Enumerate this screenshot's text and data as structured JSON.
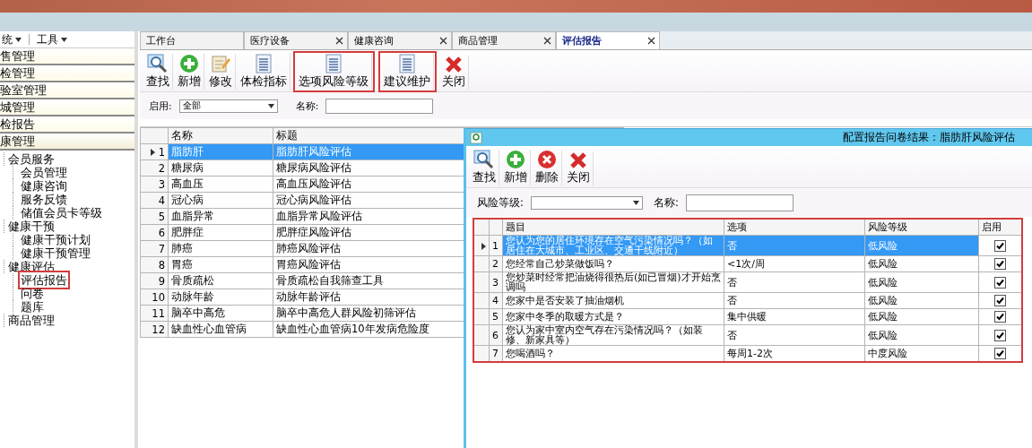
{
  "menu": [
    {
      "label": "统"
    },
    {
      "label": "工具"
    }
  ],
  "nav_sections": [
    {
      "label": "售管理",
      "expanded": false
    },
    {
      "label": "检管理",
      "expanded": false
    },
    {
      "label": "验室管理",
      "expanded": false
    },
    {
      "label": "城管理",
      "expanded": false
    },
    {
      "label": "检报告",
      "expanded": false
    },
    {
      "label": "康管理",
      "expanded": true
    }
  ],
  "tree": [
    {
      "label": "会员服务",
      "children": [
        {
          "label": "会员管理"
        },
        {
          "label": "健康咨询"
        },
        {
          "label": "服务反馈"
        },
        {
          "label": "储值会员卡等级"
        }
      ]
    },
    {
      "label": "健康干预",
      "children": [
        {
          "label": "健康干预计划"
        },
        {
          "label": "健康干预管理"
        }
      ]
    },
    {
      "label": "健康评估",
      "children": [
        {
          "label": "评估报告",
          "annotated": true
        },
        {
          "label": "问卷"
        },
        {
          "label": "题库"
        }
      ]
    },
    {
      "label": "商品管理"
    }
  ],
  "tabs": [
    {
      "label": "工作台",
      "closable": false,
      "selected": false
    },
    {
      "label": "医疗设备",
      "closable": true,
      "selected": false
    },
    {
      "label": "健康咨询",
      "closable": true,
      "selected": false
    },
    {
      "label": "商品管理",
      "closable": true,
      "selected": false
    },
    {
      "label": "评估报告",
      "closable": true,
      "selected": true
    }
  ],
  "toolbar": [
    {
      "label": "查找",
      "kind": "search"
    },
    {
      "label": "新增",
      "kind": "add"
    },
    {
      "label": "修改",
      "kind": "edit"
    },
    {
      "label": "体检指标",
      "kind": "doc"
    },
    {
      "label": "选项风险等级",
      "kind": "doc",
      "annotated": true
    },
    {
      "label": "建议维护",
      "kind": "doc",
      "annotated": true
    },
    {
      "label": "关闭",
      "kind": "close"
    }
  ],
  "filter": {
    "enabled_label": "启用:",
    "enabled_value": "全部",
    "name_label": "名称:"
  },
  "grid": {
    "columns": [
      "名称",
      "标题"
    ],
    "rows": [
      {
        "index": "1",
        "name": "脂肪肝",
        "title": "脂肪肝风险评估",
        "selected": true
      },
      {
        "index": "2",
        "name": "糖尿病",
        "title": "糖尿病风险评估",
        "selected": false
      },
      {
        "index": "3",
        "name": "高血压",
        "title": "高血压风险评估",
        "selected": false
      },
      {
        "index": "4",
        "name": "冠心病",
        "title": "冠心病风险评估",
        "selected": false
      },
      {
        "index": "5",
        "name": "血脂异常",
        "title": "血脂异常风险评估",
        "selected": false
      },
      {
        "index": "6",
        "name": "肥胖症",
        "title": "肥胖症风险评估",
        "selected": false
      },
      {
        "index": "7",
        "name": "肺癌",
        "title": "肺癌风险评估",
        "selected": false
      },
      {
        "index": "8",
        "name": "胃癌",
        "title": "胃癌风险评估",
        "selected": false
      },
      {
        "index": "9",
        "name": "骨质疏松",
        "title": "骨质疏松自我筛查工具",
        "selected": false
      },
      {
        "index": "10",
        "name": "动脉年龄",
        "title": "动脉年龄评估",
        "selected": false
      },
      {
        "index": "11",
        "name": "脑卒中高危",
        "title": "脑卒中高危人群风险初筛评估",
        "selected": false
      },
      {
        "index": "12",
        "name": "缺血性心血管病",
        "title": "缺血性心血管病10年发病危险度",
        "selected": false
      }
    ]
  },
  "dialog": {
    "title": "配置报告问卷结果：脂肪肝风险评估",
    "toolbar": [
      {
        "label": "查找",
        "kind": "search"
      },
      {
        "label": "新增",
        "kind": "add"
      },
      {
        "label": "删除",
        "kind": "delete"
      },
      {
        "label": "关闭",
        "kind": "close"
      }
    ],
    "filter": {
      "level_label": "风险等级:",
      "name_label": "名称:"
    },
    "grid": {
      "annotated": true,
      "columns": [
        "题目",
        "选项",
        "风险等级",
        "启用"
      ],
      "rows": [
        {
          "index": "1",
          "question": "您认为您的居住环境存在空气污染情况吗？（如居住在大城市、工业区、交通干线附近）",
          "option": "否",
          "level": "低风险",
          "enabled": true,
          "selected": true
        },
        {
          "index": "2",
          "question": "您经常自己炒菜做饭吗？",
          "option": "<1次/周",
          "level": "低风险",
          "enabled": true,
          "selected": false
        },
        {
          "index": "3",
          "question": "您炒菜时经常把油烧得很热后(如已冒烟)才开始烹调吗",
          "option": "否",
          "level": "低风险",
          "enabled": true,
          "selected": false
        },
        {
          "index": "4",
          "question": "您家中是否安装了抽油烟机",
          "option": "否",
          "level": "低风险",
          "enabled": true,
          "selected": false
        },
        {
          "index": "5",
          "question": "您家中冬季的取暖方式是？",
          "option": "集中供暖",
          "level": "低风险",
          "enabled": true,
          "selected": false
        },
        {
          "index": "6",
          "question": "您认为家中室内空气存在污染情况吗？（如装修、新家具等）",
          "option": "否",
          "level": "低风险",
          "enabled": true,
          "selected": false
        },
        {
          "index": "7",
          "question": "您喝酒吗？",
          "option": "每周1-2次",
          "level": "中度风险",
          "enabled": true,
          "selected": false
        }
      ]
    }
  }
}
